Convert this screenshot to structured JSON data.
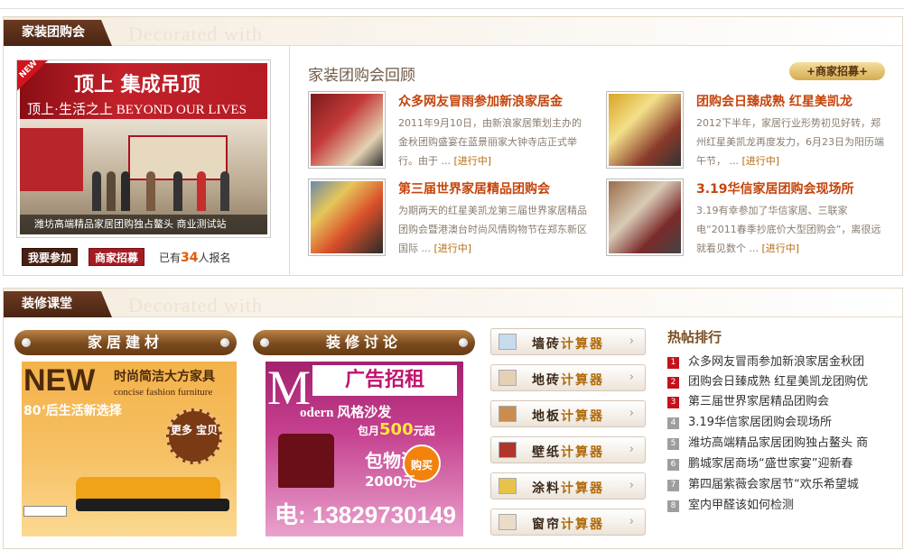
{
  "group_buy": {
    "section_label": "家装团购会",
    "watermark": "Decorated with",
    "feature": {
      "ribbon": "NEW",
      "banner_brand": "顶上 集成吊顶",
      "banner_slogan": "顶上·生活之上 BEYOND OUR LIVES",
      "caption": "潍坊高端精品家居团购独占鳌头 商业测试站"
    },
    "join_button": "我要参加",
    "merchant_button": "商家招募",
    "signup_prefix": "已有",
    "signup_count": "34",
    "signup_suffix": "人报名",
    "review_title": "家装团购会回顾",
    "merchant_pill": "+商家招募+",
    "news": [
      {
        "title": "众多网友冒雨参加新浪家居金",
        "body": "2011年9月10日，由新浪家居策划主办的金秋团购盛宴在蓝景丽家大钟寺店正式举行。由于 ...",
        "more": "[进行中]",
        "tone": "#c53a3a"
      },
      {
        "title": "团购会日臻成熟 红星美凯龙",
        "body": "2012下半年，家居行业形势初见好转，郑州红星美凯龙再度发力，6月23日为阳历端午节， ...",
        "more": "[进行中]",
        "tone": "#d9a425"
      },
      {
        "title": "第三届世界家居精品团购会",
        "body": "为期两天的红星美凯龙第三届世界家居精品团购会暨港澳台时尚风情购物节在郑东新区国际 ...",
        "more": "[进行中]",
        "tone": "#d94f2a"
      },
      {
        "title": "3.19华信家居团购会现场所",
        "body": "3.19有幸参加了华信家居、三联家电“2011春季抄底价大型团购会”，离很远就看见数个 ...",
        "more": "[进行中]",
        "tone": "#9a6e4a"
      }
    ]
  },
  "decorate": {
    "section_label": "装修课堂",
    "watermark": "Decorated with",
    "col1_title": "家居建材",
    "col2_title": "装修讨论",
    "ad1": {
      "headline": "NEW",
      "line1": "时尚简洁大方家具",
      "line2": "concise fashion furniture",
      "line3": "80‘后生活新选择",
      "badge": "更多 宝贝"
    },
    "ad2": {
      "big_letter": "M",
      "title": "广告招租",
      "line1": "odern 风格沙发",
      "line2_prefix": "包月",
      "line2_price": "500",
      "line2_suffix": "元起",
      "line3": "包物流",
      "line4": "2000元",
      "buy": "购买",
      "phone": "电: 13829730149"
    },
    "calculators": [
      {
        "name": "墙砖",
        "suffix": "计算器",
        "icon": "wall-tile-icon",
        "color": "#c6dbee"
      },
      {
        "name": "地砖",
        "suffix": "计算器",
        "icon": "floor-tile-icon",
        "color": "#e7cfb4"
      },
      {
        "name": "地板",
        "suffix": "计算器",
        "icon": "floorboard-icon",
        "color": "#c98d50"
      },
      {
        "name": "壁纸",
        "suffix": "计算器",
        "icon": "wallpaper-icon",
        "color": "#b0352c"
      },
      {
        "name": "涂料",
        "suffix": "计算器",
        "icon": "paint-icon",
        "color": "#e8c34a"
      },
      {
        "name": "窗帘",
        "suffix": "计算器",
        "icon": "curtain-icon",
        "color": "#eadcc8"
      }
    ],
    "calc_arrow": "›",
    "hot_title": "热帖排行",
    "hot_posts": [
      {
        "rank": "1",
        "text": "众多网友冒雨参加新浪家居金秋团"
      },
      {
        "rank": "2",
        "text": "团购会日臻成熟 红星美凯龙团购优"
      },
      {
        "rank": "3",
        "text": "第三届世界家居精品团购会"
      },
      {
        "rank": "4",
        "text": "3.19华信家居团购会现场所"
      },
      {
        "rank": "5",
        "text": "潍坊高端精品家居团购独占鳌头 商"
      },
      {
        "rank": "6",
        "text": "鹏城家居商场“盛世家宴”迎新春"
      },
      {
        "rank": "7",
        "text": "第四届紫薇会家居节“欢乐希望城"
      },
      {
        "rank": "8",
        "text": "室内甲醛该如何检测"
      }
    ]
  }
}
